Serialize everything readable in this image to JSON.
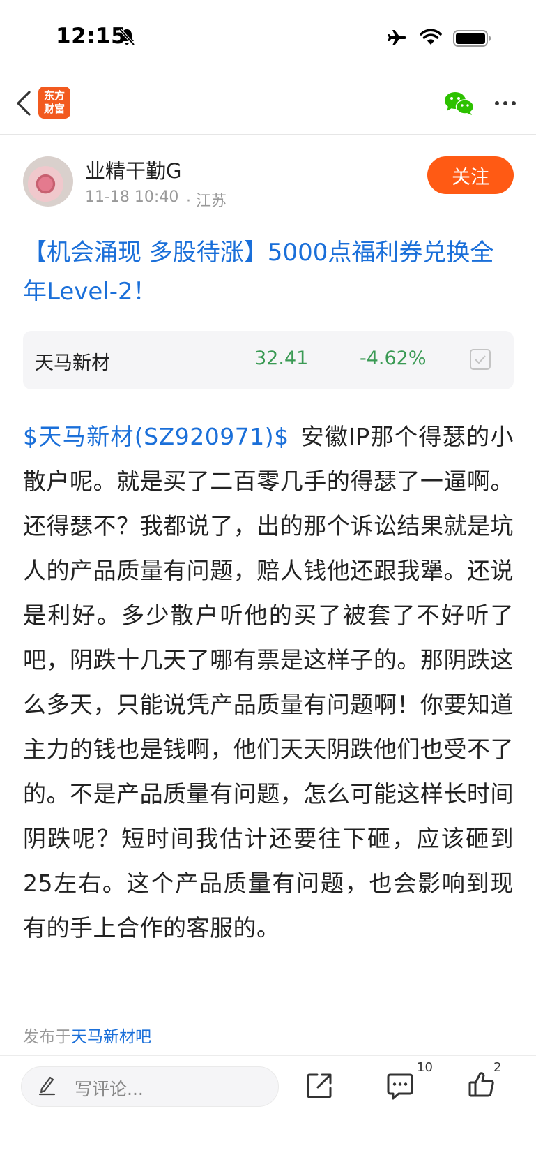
{
  "status_bar": {
    "time": "12:15",
    "icons": [
      "bell-off-icon",
      "airplane-icon",
      "wifi-icon",
      "battery-icon"
    ]
  },
  "nav": {
    "logo_line1": "东方",
    "logo_line2": "财富",
    "icons": [
      "back-icon",
      "wechat-icon",
      "more-icon"
    ]
  },
  "author": {
    "name": "业精干勤G",
    "time": "11-18 10:40",
    "location": "· 江苏",
    "follow_label": "关注"
  },
  "post": {
    "title": "【机会涌现 多股待涨】5000点福利券兑换全年Level-2！",
    "stock": {
      "name": "天马新材",
      "price": "32.41",
      "change": "-4.62%"
    },
    "stock_tag": "$天马新材(SZ920971)$",
    "body": "安徽IP那个得瑟的小散户呢。就是买了二百零几手的得瑟了一逼啊。还得瑟不？我都说了，出的那个诉讼结果就是坑人的产品质量有问题，赔人钱他还跟我犟。还说是利好。多少散户听他的买了被套了不好听了吧，阴跌十几天了哪有票是这样子的。那阴跌这么多天，只能说凭产品质量有问题啊！你要知道主力的钱也是钱啊，他们天天阴跌他们也受不了的。不是产品质量有问题，怎么可能这样长时间阴跌呢？短时间我估计还要往下砸，应该砸到25左右。这个产品质量有问题，也会影响到现有的手上合作的客服的。",
    "published_prefix": "发布于",
    "published_forum": "天马新材吧"
  },
  "bottom_bar": {
    "comment_placeholder": "写评论...",
    "comment_count": "10",
    "like_count": "2"
  },
  "colors": {
    "accent_orange": "#ff5a14",
    "link_blue": "#1a6fd9",
    "down_green": "#3a9a54",
    "wechat_green": "#2dc100"
  }
}
